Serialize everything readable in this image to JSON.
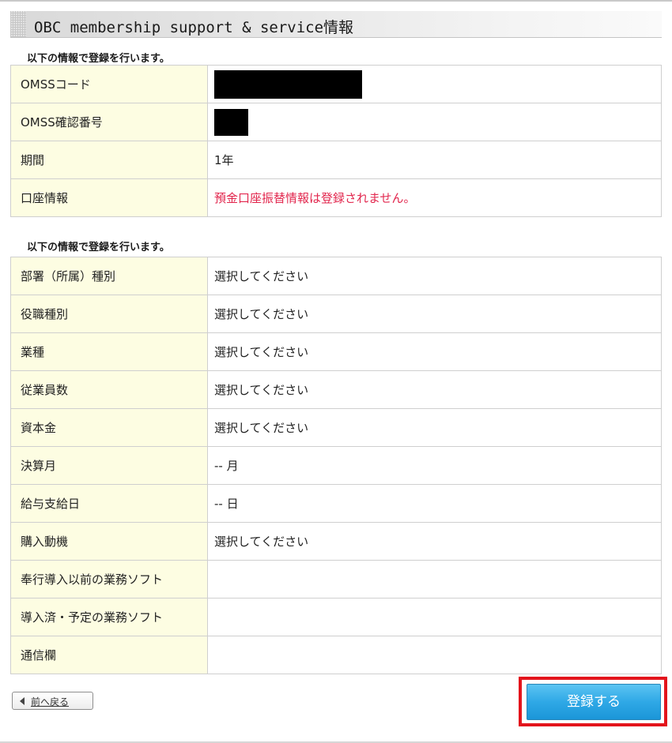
{
  "header": {
    "title": "OBC membership support & service情報"
  },
  "section1": {
    "subtitle": "以下の情報で登録を行います。",
    "rows": [
      {
        "label": "OMSSコード",
        "value": null,
        "redacted": true
      },
      {
        "label": "OMSS確認番号",
        "value": null,
        "redacted": true
      },
      {
        "label": "期間",
        "value": "1年"
      },
      {
        "label": "口座情報",
        "value": "預金口座振替情報は登録されません。",
        "status": "warning"
      }
    ]
  },
  "section2": {
    "subtitle": "以下の情報で登録を行います。",
    "rows": [
      {
        "label": "部署（所属）種別",
        "value": "選択してください"
      },
      {
        "label": "役職種別",
        "value": "選択してください"
      },
      {
        "label": "業種",
        "value": "選択してください"
      },
      {
        "label": "従業員数",
        "value": "選択してください"
      },
      {
        "label": "資本金",
        "value": "選択してください"
      },
      {
        "label": "決算月",
        "value": "-- 月"
      },
      {
        "label": "給与支給日",
        "value": "-- 日"
      },
      {
        "label": "購入動機",
        "value": "選択してください"
      },
      {
        "label": "奉行導入以前の業務ソフト",
        "value": ""
      },
      {
        "label": "導入済・予定の業務ソフト",
        "value": ""
      },
      {
        "label": "通信欄",
        "value": ""
      }
    ]
  },
  "footer": {
    "back_label": "前へ戻る",
    "back_icon": "left-triangle-icon",
    "register_label": "登録する"
  },
  "colors": {
    "label_background": "#fdfde2",
    "warning_text": "#e2264d",
    "register_button": "#2fa8e6",
    "highlight_frame": "#e3141c"
  }
}
